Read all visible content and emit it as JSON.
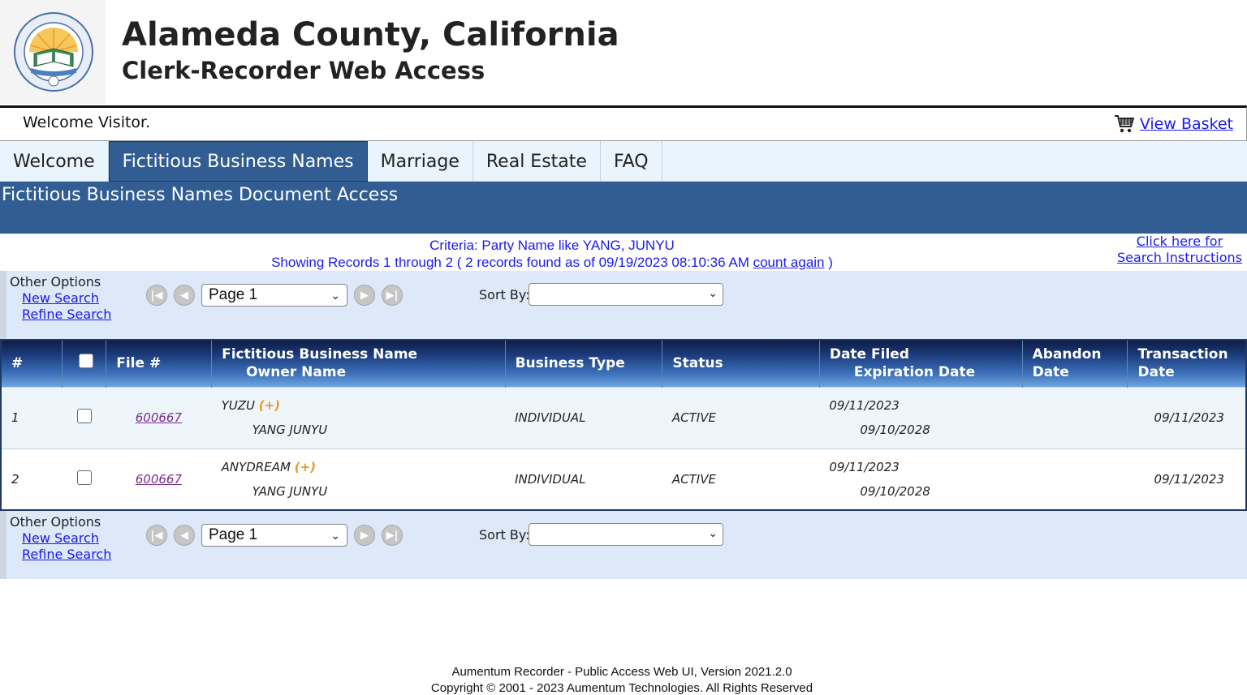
{
  "header": {
    "title": "Alameda County, California",
    "subtitle": "Clerk-Recorder Web Access"
  },
  "welcome": {
    "text": "Welcome Visitor.",
    "basket_label": "View Basket"
  },
  "tabs": [
    {
      "label": "Welcome",
      "active": false
    },
    {
      "label": "Fictitious Business Names",
      "active": true
    },
    {
      "label": "Marriage",
      "active": false
    },
    {
      "label": "Real Estate",
      "active": false
    },
    {
      "label": "FAQ",
      "active": false
    }
  ],
  "banner": {
    "title": "Fictitious Business Names Document Access"
  },
  "criteria": {
    "line1": "Criteria:  Party Name like YANG, JUNYU",
    "line2_prefix": "Showing Records 1 through 2 ( 2 records found as of 09/19/2023 08:10:36 AM ",
    "count_again": "count again",
    "line2_suffix": " )"
  },
  "instructions": {
    "line1": "Click here for",
    "line2": "Search Instructions"
  },
  "options": {
    "label": "Other Options",
    "new_search": "New Search",
    "refine_search": "Refine Search",
    "page_value": "Page 1",
    "sort_label": "Sort By:"
  },
  "table": {
    "headers": {
      "num": "#",
      "file": "File #",
      "name_line1": "Fictitious Business Name",
      "name_line2": "Owner Name",
      "type": "Business Type",
      "status": "Status",
      "date_line1": "Date Filed",
      "date_line2": "Expiration Date",
      "abandon_line1": "Abandon",
      "abandon_line2": "Date",
      "trans_line1": "Transaction",
      "trans_line2": "Date"
    },
    "rows": [
      {
        "num": "1",
        "file": "600667",
        "business_name": "YUZU",
        "plus": "(+)",
        "owner": "YANG JUNYU",
        "type": "INDIVIDUAL",
        "status": "ACTIVE",
        "date_filed": "09/11/2023",
        "expiration": "09/10/2028",
        "abandon": "",
        "transaction": "09/11/2023"
      },
      {
        "num": "2",
        "file": "600667",
        "business_name": "ANYDREAM",
        "plus": "(+)",
        "owner": "YANG JUNYU",
        "type": "INDIVIDUAL",
        "status": "ACTIVE",
        "date_filed": "09/11/2023",
        "expiration": "09/10/2028",
        "abandon": "",
        "transaction": "09/11/2023"
      }
    ]
  },
  "footer": {
    "line1": "Aumentum Recorder - Public Access Web UI, Version 2021.2.0",
    "line2": "Copyright © 2001 - 2023  Aumentum Technologies. All Rights Reserved"
  },
  "icons": {
    "first": "first-page-icon",
    "prev": "previous-page-icon",
    "next": "next-page-icon",
    "last": "last-page-icon",
    "basket": "shopping-cart-icon"
  },
  "colors": {
    "banner": "#315d92",
    "link": "#1a1aee",
    "visited_link": "#7b2b8f",
    "options_bg": "#dde8f9",
    "tabs_bg": "#e9f4fc",
    "plus": "#e89b22"
  }
}
